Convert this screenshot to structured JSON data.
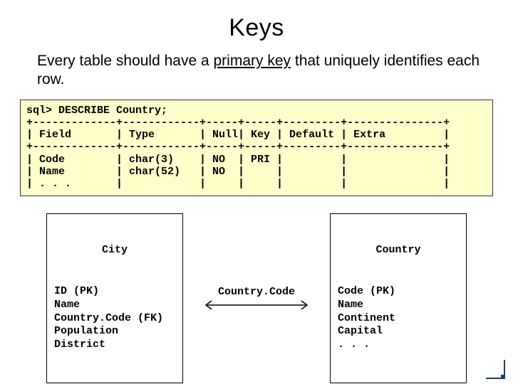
{
  "title": "Keys",
  "body": {
    "pre": "Every table should have a ",
    "underlined": "primary key",
    "post": " that uniquely identifies each row."
  },
  "sql": {
    "cmd": "sql> DESCRIBE Country;",
    "sep": "+-------------+------------+-----+-----+---------+---------------+",
    "header": "| Field       | Type       | Null| Key | Default | Extra         |",
    "row1": "| Code        | char(3)    | NO  | PRI |         |               |",
    "row2": "| Name        | char(52)   | NO  |     |         |               |",
    "row3": "| . . .       |            |     |     |         |               |"
  },
  "city": {
    "title": "City",
    "rows": "ID (PK)\nName\nCountry.Code (FK)\nPopulation\nDistrict"
  },
  "relation_label": "Country.Code",
  "country": {
    "title": "Country",
    "rows": "Code (PK)\nName\nContinent\nCapital\n. . ."
  }
}
